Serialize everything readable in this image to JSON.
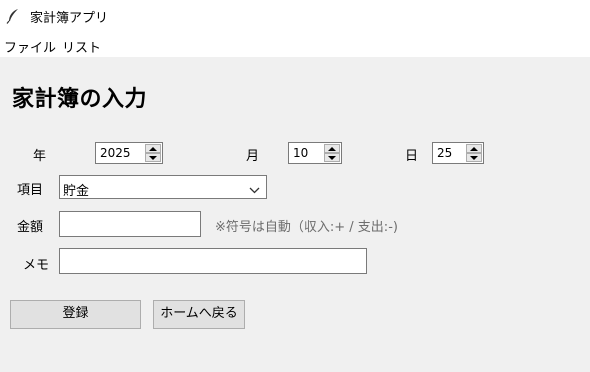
{
  "window": {
    "title": "家計簿アプリ",
    "icon": "feather-icon"
  },
  "menu": {
    "items": [
      "ファイル",
      "リスト"
    ]
  },
  "form": {
    "heading": "家計簿の入力",
    "year": {
      "label": "年",
      "value": "2025"
    },
    "month": {
      "label": "月",
      "value": "10"
    },
    "day": {
      "label": "日",
      "value": "25"
    },
    "category": {
      "label": "項目",
      "value": "貯金"
    },
    "amount": {
      "label": "金額",
      "value": "",
      "hint": "※符号は自動（収入:+ / 支出:-)"
    },
    "memo": {
      "label": "メモ",
      "value": ""
    }
  },
  "buttons": {
    "register": "登録",
    "home": "ホームへ戻る"
  }
}
